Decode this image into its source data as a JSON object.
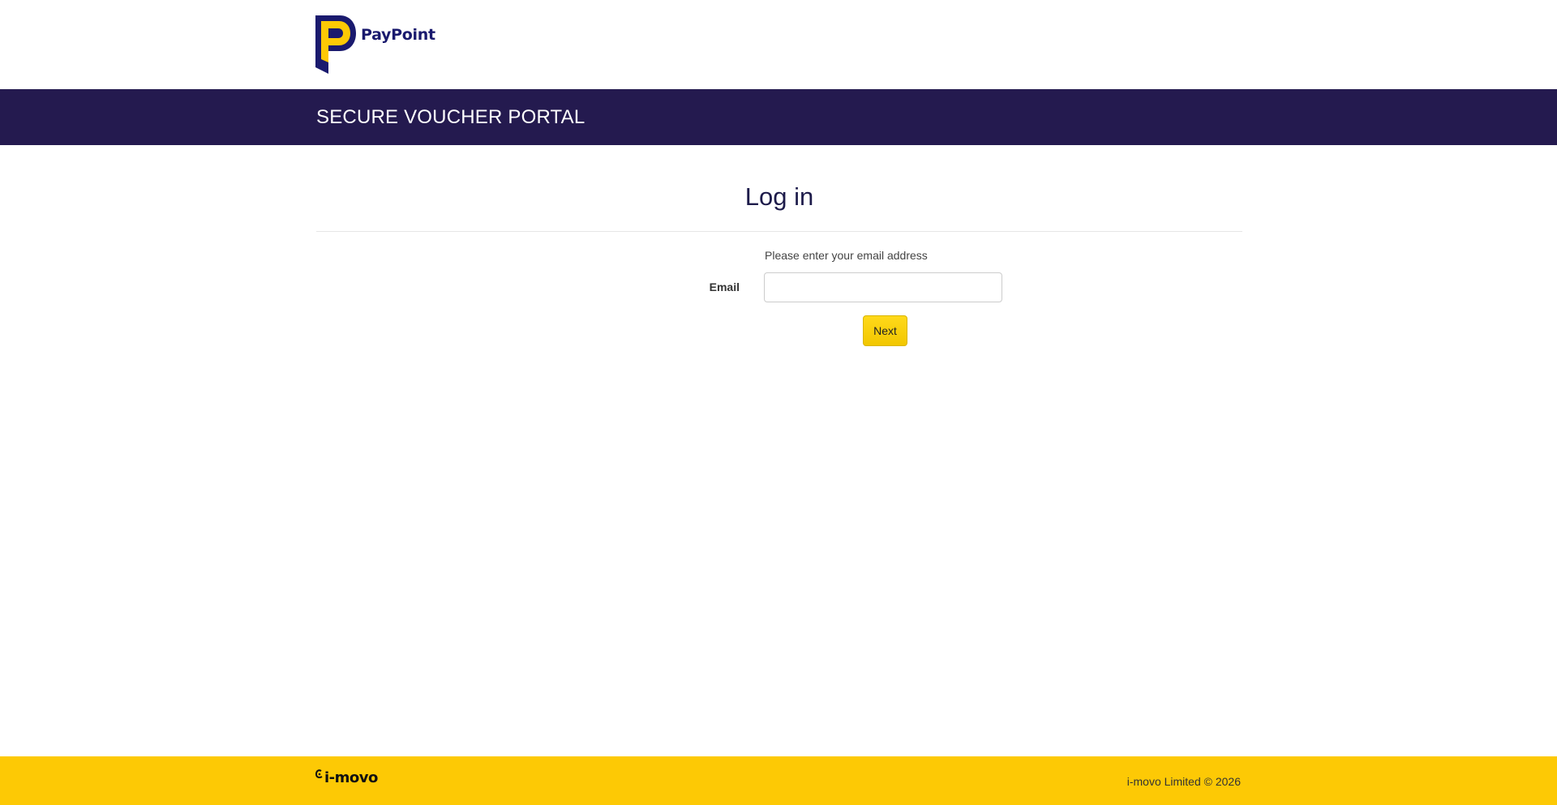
{
  "header": {
    "logo_text": "PayPoint",
    "logo_colors": {
      "navy": "#1a1a6e",
      "yellow": "#fdc905"
    }
  },
  "banner": {
    "title": "SECURE VOUCHER PORTAL",
    "background": "#241a4f"
  },
  "login": {
    "title": "Log in",
    "instructions": "Please enter your email address",
    "email_label": "Email",
    "email_value": "",
    "next_label": "Next"
  },
  "footer": {
    "logo_text": "i-movo",
    "copyright": "i-movo Limited © 2026",
    "background": "#fdc905"
  }
}
